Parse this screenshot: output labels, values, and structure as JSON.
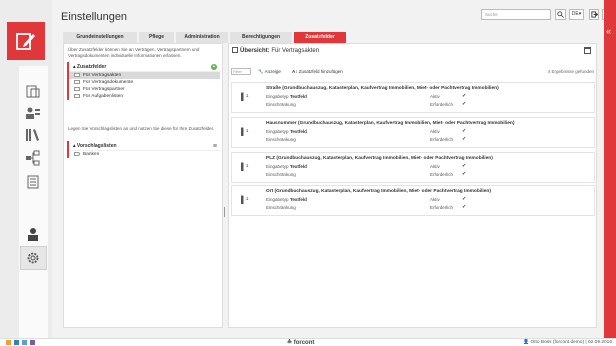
{
  "header": {
    "title": "Einstellungen",
    "search_placeholder": "Suche",
    "language": "DE",
    "language_caret": "▾"
  },
  "tabs": [
    {
      "label": "Grundeinstellungen"
    },
    {
      "label": "Pflege"
    },
    {
      "label": "Administration"
    },
    {
      "label": "Berechtigungen"
    },
    {
      "label": "Zusatzfelder"
    }
  ],
  "left_panel": {
    "description": "Über Zusatzfelder können Sie an Verträgen, Vertragspartnern und Vertragsdokumenten individuelle Informationen erfassen.",
    "zusatzfelder": {
      "heading": "Zusatzfelder",
      "items": [
        {
          "label": "Für Vertragsakten"
        },
        {
          "label": "Für Vertragsdokumente"
        },
        {
          "label": "Für Vertragspartner"
        },
        {
          "label": "Für Aufgabenlisten"
        }
      ]
    },
    "lists_description": "Legen Sie Vorschlagslisten an und nutzen Sie diese für Ihre Zusatzfelder.",
    "vorschlagslisten": {
      "heading": "Vorschlagslisten",
      "items": [
        {
          "label": "Banken"
        }
      ]
    }
  },
  "right_panel": {
    "title_prefix": "Übersicht:",
    "title_value": "Für Vertragsakten",
    "filter_placeholder": "Filter",
    "anzeige_label": "Anzeige",
    "add_label": "Zusatzfeld hinzufügen",
    "results": "4 Ergebnisse gefunden",
    "field_labels": {
      "eingabetyp": "Eingabetyp",
      "einschraenkung": "Einschränkung",
      "aktiv": "Aktiv",
      "erforderlich": "Erforderlich"
    },
    "check": "✓",
    "cards": [
      {
        "title": "Straße (Grundbuchauszug, Katasterplan, Kaufvertrag Immobilien, Miet- oder Pachtvertrag Immobilien)",
        "eingabetyp": "Textfeld"
      },
      {
        "title": "Hausnummer (Grundbuchauszug, Katasterplan, Kaufvertrag Immobilien, Miet- oder Pachtvertrag Immobilien)",
        "eingabetyp": "Textfeld"
      },
      {
        "title": "PLZ (Grundbuchauszug, Katasterplan, Kaufvertrag Immobilien, Miet- oder Pachtvertrag Immobilien)",
        "eingabetyp": "Textfeld"
      },
      {
        "title": "Ort (Grundbuchauszug, Katasterplan, Kaufvertrag Immobilien, Miet- oder Pachtvertrag Immobilien)",
        "eingabetyp": "Textfeld"
      }
    ]
  },
  "footer": {
    "brand": "forcont",
    "user": "Otto Boss (forcont.demo) | 02.09.2016"
  },
  "colors": {
    "accent": "#e0373a",
    "success": "#5ab24a"
  }
}
